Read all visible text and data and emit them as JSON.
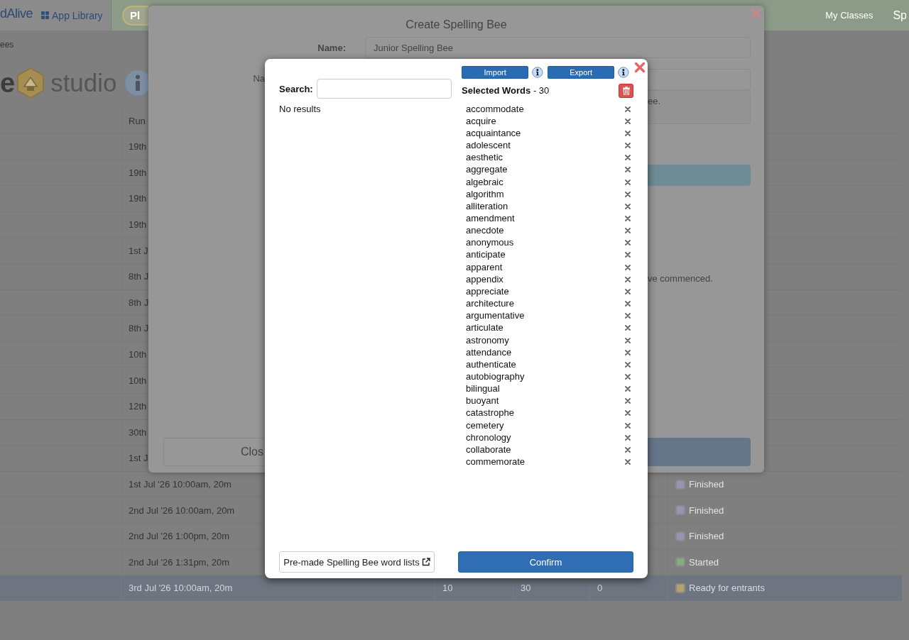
{
  "page": {
    "nav": {
      "brand": "dAlive",
      "app_library": "App Library",
      "pill": "Pl",
      "links": [
        "My Classes",
        "Sp"
      ]
    },
    "breadcrumb": "ees",
    "heading": {
      "letter": "e",
      "title": "studio"
    },
    "table": {
      "columns": [
        "Run"
      ],
      "rows": [
        {
          "run": "19th",
          "selected": false
        },
        {
          "run": "19th",
          "selected": false
        },
        {
          "run": "19th",
          "selected": false
        },
        {
          "run": "19th",
          "selected": false
        },
        {
          "run": "1st J",
          "selected": false
        },
        {
          "run": "8th J",
          "selected": false
        },
        {
          "run": "8th J",
          "selected": false
        },
        {
          "run": "8th J",
          "selected": false
        },
        {
          "run": "10th",
          "selected": false
        },
        {
          "run": "10th",
          "selected": false
        },
        {
          "run": "12th",
          "selected": false
        },
        {
          "run": "30th",
          "selected": false
        },
        {
          "run": "1st J",
          "selected": false
        },
        {
          "run": "1st Jul '26 10:00am, 20m",
          "column_6": {
            "label": "Finished",
            "color": "#9895b2"
          },
          "selected": false
        },
        {
          "run": "2nd Jul '26 10:00am, 20m",
          "column_6": {
            "label": "Finished",
            "color": "#9895b2"
          },
          "selected": false
        },
        {
          "run": "2nd Jul '26 1:00pm, 20m",
          "column_6": {
            "label": "Finished",
            "color": "#9895b2"
          },
          "selected": false
        },
        {
          "run": "2nd Jul '26 1:31pm, 20m",
          "column_6": {
            "label": "Started",
            "color": "#86aa82"
          },
          "selected": false
        },
        {
          "run": "3rd Jul '26 10:00am, 20m",
          "column_3": "10",
          "column_4": "30",
          "column_5": "0",
          "column_6": {
            "label": "Ready for entrants",
            "color": "#b5a36c"
          },
          "selected": true
        }
      ]
    }
  },
  "create_dialog": {
    "title": "Create Spelling Bee",
    "name_label": "Name:",
    "name_value": "Junior Spelling Bee",
    "second_label": "Na",
    "note_text": "ee.",
    "notice_text": "ve commenced.",
    "close_button": "Clos"
  },
  "word_dialog": {
    "import_button": "Import",
    "export_button": "Export",
    "search_label": "Search:",
    "no_results": "No results",
    "selected_heading": "**Selected Words** - 30",
    "words": [
      "accommodate",
      "acquire",
      "acquaintance",
      "adolescent",
      "aesthetic",
      "aggregate",
      "algebraic",
      "algorithm",
      "alliteration",
      "amendment",
      "anecdote",
      "anonymous",
      "anticipate",
      "apparent",
      "appendix",
      "appreciate",
      "architecture",
      "argumentative",
      "articulate",
      "astronomy",
      "attendance",
      "authenticate",
      "autobiography",
      "bilingual",
      "buoyant",
      "catastrophe",
      "cemetery",
      "chronology",
      "collaborate",
      "commemorate"
    ],
    "premade_button": "Pre-made Spelling Bee word lists",
    "confirm_button": "Confirm"
  }
}
